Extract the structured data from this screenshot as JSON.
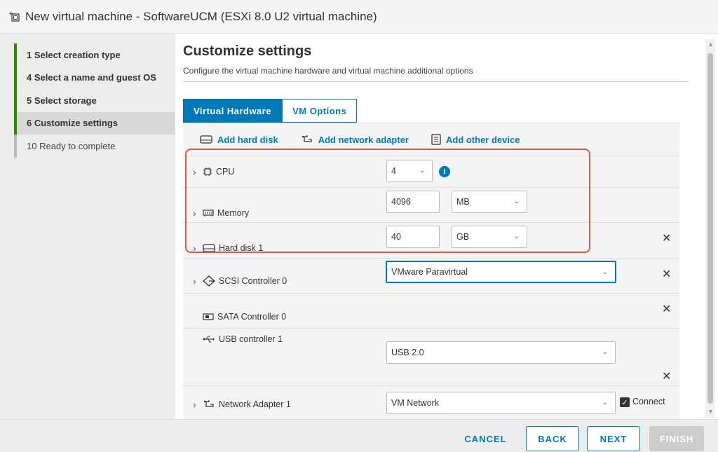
{
  "window": {
    "title": "New virtual machine - SoftwareUCM (ESXi 8.0 U2 virtual machine)"
  },
  "steps": [
    {
      "label": "1  Select creation type",
      "state": "done"
    },
    {
      "label": "4  Select a name and guest OS",
      "state": "done"
    },
    {
      "label": "5  Select storage",
      "state": "done"
    },
    {
      "label": "6  Customize settings",
      "state": "active"
    },
    {
      "label": "10  Ready to complete",
      "state": "pending"
    }
  ],
  "page": {
    "title": "Customize settings",
    "subtitle": "Configure the virtual machine hardware and virtual machine additional options"
  },
  "tabs": [
    {
      "label": "Virtual Hardware",
      "active": true
    },
    {
      "label": "VM Options",
      "active": false
    }
  ],
  "add_actions": {
    "hard_disk": "Add hard disk",
    "network_adapter": "Add network adapter",
    "other_device": "Add other device"
  },
  "hardware": {
    "cpu": {
      "label": "CPU",
      "value": "4"
    },
    "memory": {
      "label": "Memory",
      "value": "4096",
      "unit": "MB"
    },
    "hard_disk": {
      "label": "Hard disk 1",
      "value": "40",
      "unit": "GB"
    },
    "scsi": {
      "label": "SCSI Controller 0",
      "value": "VMware Paravirtual"
    },
    "sata": {
      "label": "SATA Controller 0"
    },
    "usb": {
      "label": "USB controller 1",
      "value": "USB 2.0"
    },
    "network": {
      "label": "Network Adapter 1",
      "value": "VM Network",
      "connect_label": "Connect",
      "connected": true
    }
  },
  "footer": {
    "cancel": "CANCEL",
    "back": "BACK",
    "next": "NEXT",
    "finish": "FINISH"
  },
  "colors": {
    "accent": "#0079b8",
    "step_done": "#318700",
    "highlight": "#e8553d"
  }
}
